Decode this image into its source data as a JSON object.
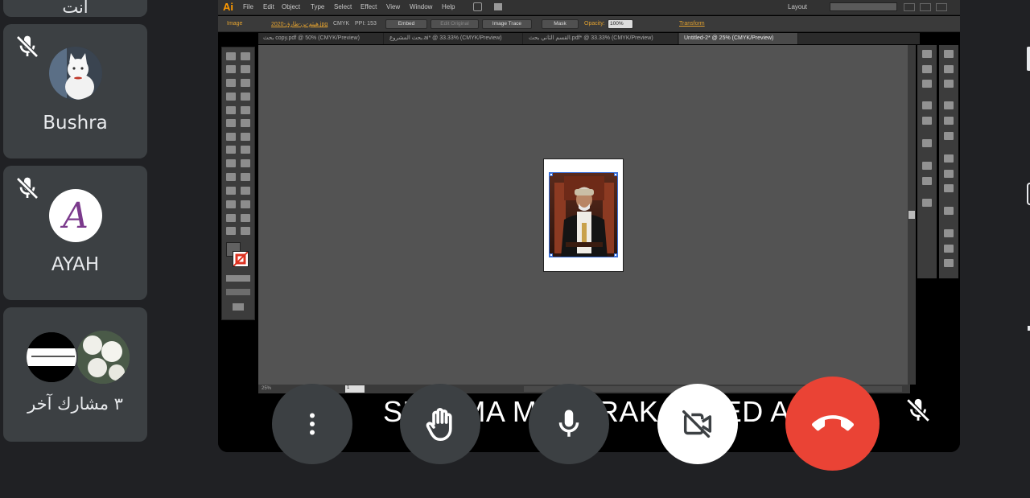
{
  "participants": [
    {
      "name": "أنت"
    },
    {
      "name": "Bushra",
      "muted": true
    },
    {
      "name": "AYAH",
      "muted": true,
      "avatar_letter": "A"
    },
    {
      "name": "٣ مشارك آخر"
    }
  ],
  "illustrator": {
    "app_logo": "Ai",
    "menus": [
      "File",
      "Edit",
      "Object",
      "Type",
      "Select",
      "Effect",
      "View",
      "Window",
      "Help"
    ],
    "workspace": "Layout",
    "control_bar": {
      "selection": "Image",
      "file_link": "هيثم-بن-طارق-2020.jpg",
      "color_mode": "CMYK",
      "ppi": "PPI: 153",
      "embed_button": "Embed",
      "edit_original_button": "Edit Original",
      "image_trace_button": "Image Trace",
      "mask_button": "Mask",
      "opacity_label": "Opacity:",
      "opacity_value": "100%",
      "transform_link": "Transform"
    },
    "tabs": [
      "بحث copy.pdf @ 50% (CMYK/Preview)",
      "بحث المشروع.ai* @ 33.33% (CMYK/Preview)",
      "القسم الثاني بحث.pdf* @ 33.33% (CMYK/Preview)",
      "Untitled-2* @ 25% (CMYK/Preview)"
    ],
    "zoom": "25%",
    "artboard_number": "1"
  },
  "caption": {
    "text": "SHAYMA MUBARAK ZAYED ALI"
  },
  "colors": {
    "background": "#202124",
    "tile": "#3c4043",
    "end_call": "#ea4335"
  }
}
